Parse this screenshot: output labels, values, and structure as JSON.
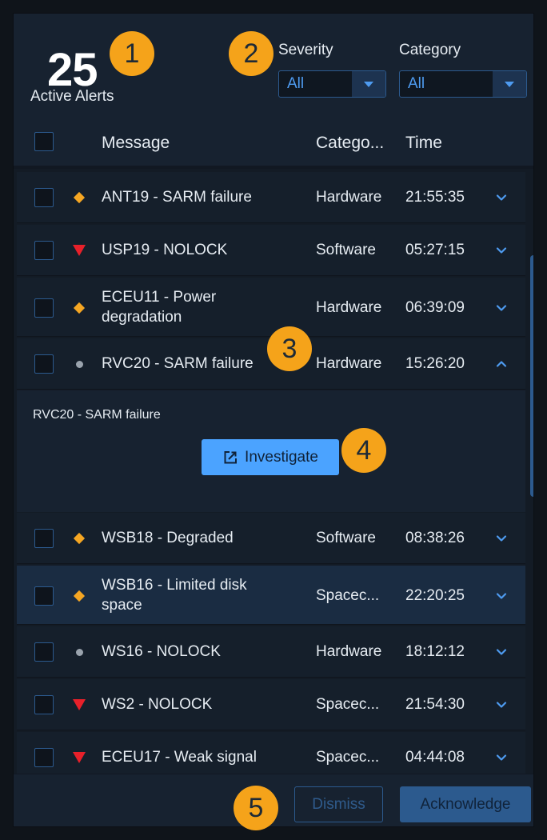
{
  "header": {
    "active_count": "25",
    "active_label": "Active Alerts",
    "severity_filter": {
      "label": "Severity",
      "value": "All"
    },
    "category_filter": {
      "label": "Category",
      "value": "All"
    }
  },
  "columns": {
    "message": "Message",
    "category": "Catego...",
    "time": "Time"
  },
  "alerts": [
    {
      "severity": "serious",
      "message": "ANT19 - SARM failure",
      "category": "Hardware",
      "time": "21:55:35",
      "expanded": false
    },
    {
      "severity": "critical",
      "message": "USP19 - NOLOCK",
      "category": "Software",
      "time": "05:27:15",
      "expanded": false
    },
    {
      "severity": "serious",
      "message": "ECEU11 - Power degradation",
      "category": "Hardware",
      "time": "06:39:09",
      "expanded": false
    },
    {
      "severity": "normal",
      "message": "RVC20 - SARM failure",
      "category": "Hardware",
      "time": "15:26:20",
      "expanded": true
    },
    {
      "severity": "serious",
      "message": "WSB18 - Degraded",
      "category": "Software",
      "time": "08:38:26",
      "expanded": false
    },
    {
      "severity": "serious",
      "message": "WSB16 - Limited disk space",
      "category": "Spacec...",
      "time": "22:20:25",
      "expanded": false,
      "highlighted": true
    },
    {
      "severity": "normal",
      "message": "WS16 - NOLOCK",
      "category": "Hardware",
      "time": "18:12:12",
      "expanded": false
    },
    {
      "severity": "critical",
      "message": "WS2 - NOLOCK",
      "category": "Spacec...",
      "time": "21:54:30",
      "expanded": false
    },
    {
      "severity": "critical",
      "message": "ECEU17 - Weak signal",
      "category": "Spacec...",
      "time": "04:44:08",
      "expanded": false
    }
  ],
  "expanded_detail": {
    "text": "RVC20 - SARM failure",
    "investigate_label": "Investigate"
  },
  "footer": {
    "dismiss_label": "Dismiss",
    "acknowledge_label": "Acknowledge"
  },
  "annotations": [
    "1",
    "2",
    "3",
    "4",
    "5"
  ],
  "colors": {
    "serious": "#f5a623",
    "critical": "#e8202a",
    "normal": "#9aa3ad",
    "accent": "#4ba3ff",
    "annotation": "#f5a31a"
  }
}
